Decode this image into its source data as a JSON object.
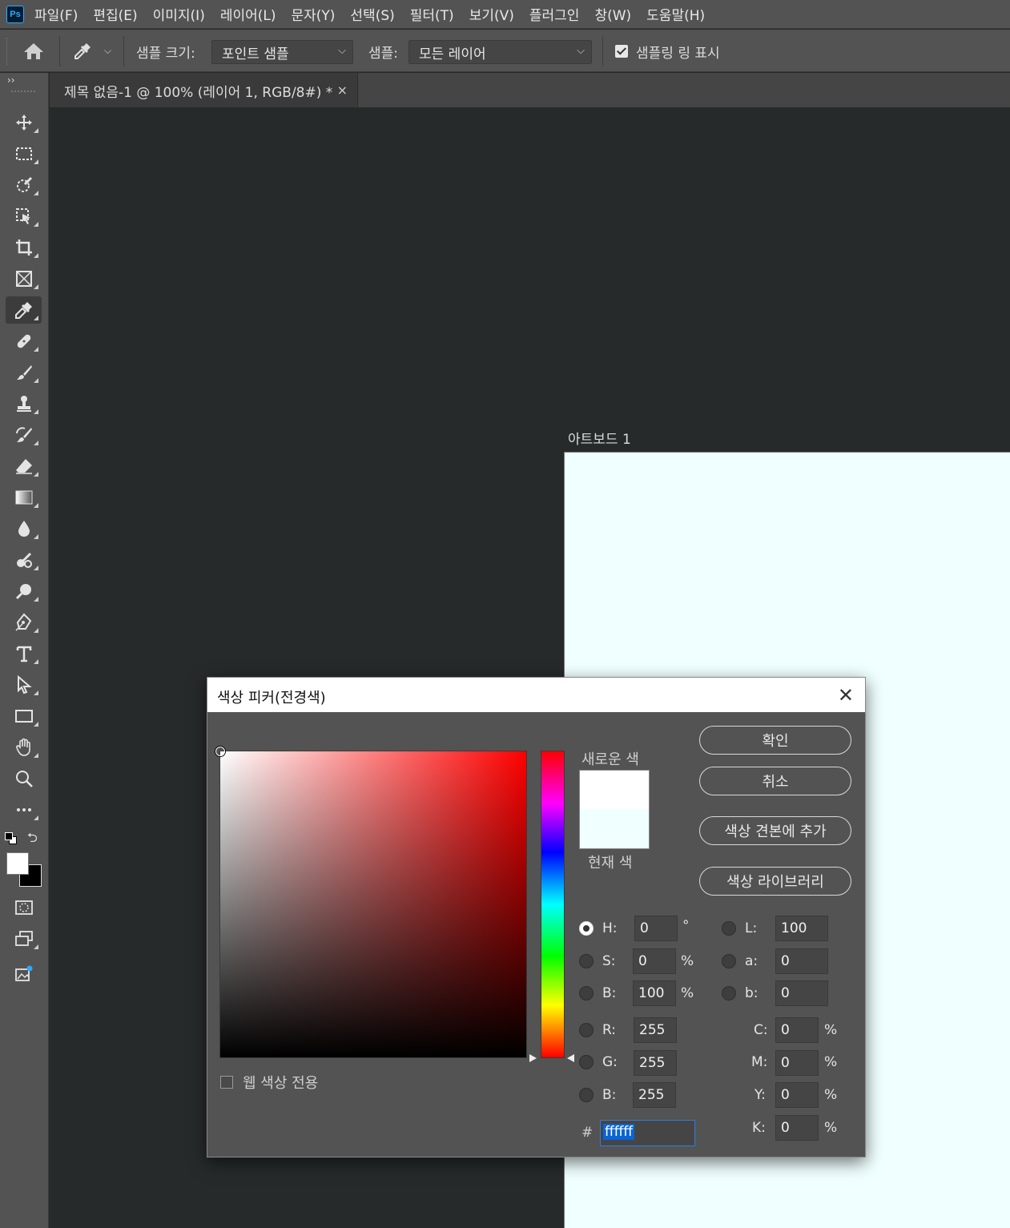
{
  "menubar": {
    "logo": "Ps",
    "items": [
      "파일(F)",
      "편집(E)",
      "이미지(I)",
      "레이어(L)",
      "문자(Y)",
      "선택(S)",
      "필터(T)",
      "보기(V)",
      "플러그인",
      "창(W)",
      "도움말(H)"
    ]
  },
  "options": {
    "sample_size_label": "샘플 크기:",
    "sample_size_value": "포인트 샘플",
    "sample_label": "샘플:",
    "sample_value": "모든 레이어",
    "show_ring_label": "샘플링 링 표시",
    "show_ring_checked": true
  },
  "toolbar": {
    "collapse_label": "››",
    "tools": [
      "move-tool",
      "marquee-tool",
      "quick-selection-tool",
      "object-selection-tool",
      "crop-tool",
      "frame-tool",
      "eyedropper-tool",
      "healing-brush-tool",
      "brush-tool",
      "clone-stamp-tool",
      "history-brush-tool",
      "eraser-tool",
      "gradient-tool",
      "blur-tool",
      "dodge-tool",
      "pen-tool",
      "type-tool",
      "path-selection-tool",
      "rectangle-tool",
      "hand-tool",
      "zoom-tool",
      "more-tools"
    ],
    "active_tool": "eyedropper-tool",
    "foreground_color": "#ffffff",
    "background_color": "#000000"
  },
  "document": {
    "tab_title": "제목 없음-1 @ 100% (레이어 1, RGB/8#) *",
    "close_glyph": "×",
    "artboard_title": "아트보드 1",
    "artboard_color": "#f0ffff"
  },
  "color_picker": {
    "title": "색상 피커(전경색)",
    "close_glyph": "✕",
    "new_color_label": "새로운 색",
    "current_color_label": "현재 색",
    "new_color": "#ffffff",
    "current_color": "#f0ffff",
    "buttons": {
      "ok": "확인",
      "cancel": "취소",
      "add_to_swatches": "색상 견본에 추가",
      "color_libraries": "색상 라이브러리"
    },
    "web_colors_only_label": "웹 색상 전용",
    "web_colors_only_checked": false,
    "selected_mode": "H",
    "fields": {
      "H": {
        "label": "H:",
        "value": "0",
        "unit": "°"
      },
      "S": {
        "label": "S:",
        "value": "0",
        "unit": "%"
      },
      "B": {
        "label": "B:",
        "value": "100",
        "unit": "%"
      },
      "R": {
        "label": "R:",
        "value": "255"
      },
      "G": {
        "label": "G:",
        "value": "255"
      },
      "Bl": {
        "label": "B:",
        "value": "255"
      },
      "L": {
        "label": "L:",
        "value": "100"
      },
      "a": {
        "label": "a:",
        "value": "0"
      },
      "b": {
        "label": "b:",
        "value": "0"
      },
      "C": {
        "label": "C:",
        "value": "0",
        "unit": "%"
      },
      "M": {
        "label": "M:",
        "value": "0",
        "unit": "%"
      },
      "Y": {
        "label": "Y:",
        "value": "0",
        "unit": "%"
      },
      "K": {
        "label": "K:",
        "value": "0",
        "unit": "%"
      }
    },
    "hex_label": "#",
    "hex_value": "ffffff",
    "hue_gradient": [
      "#ff0000",
      "#ff00ff",
      "#0000ff",
      "#00ffff",
      "#00ff00",
      "#ffff00",
      "#ff0000"
    ]
  }
}
